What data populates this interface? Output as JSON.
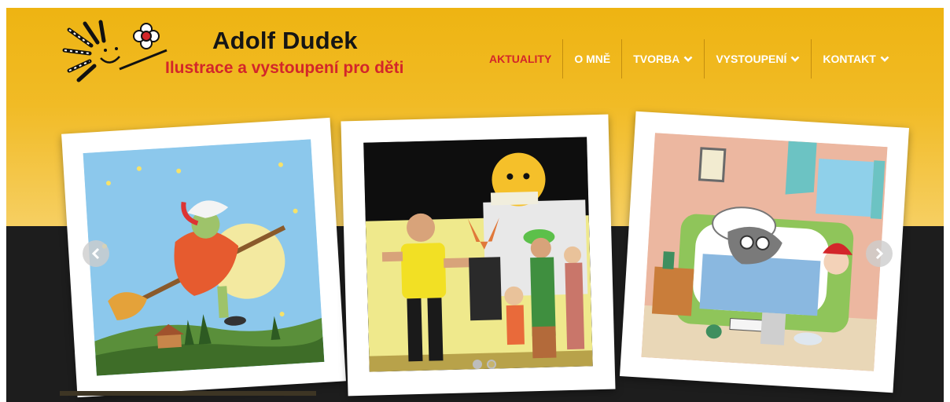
{
  "brand": {
    "name": "Adolf Dudek",
    "tagline": "Ilustrace a vystoupení pro děti"
  },
  "nav": {
    "items": [
      {
        "label": "AKTUALITY",
        "active": true,
        "dropdown": false
      },
      {
        "label": "O MNĚ",
        "active": false,
        "dropdown": false
      },
      {
        "label": "TVORBA",
        "active": false,
        "dropdown": true
      },
      {
        "label": "VYSTOUPENÍ",
        "active": false,
        "dropdown": true
      },
      {
        "label": "KONTAKT",
        "active": false,
        "dropdown": true
      }
    ]
  },
  "slider": {
    "slides": [
      {
        "subject": "witch-on-broom-illustration"
      },
      {
        "subject": "stage-performance-photo"
      },
      {
        "subject": "wolf-in-bed-illustration"
      }
    ],
    "dot_count": 2,
    "active_dot": 1
  },
  "colors": {
    "header_yellow": "#f1bb26",
    "accent_red": "#d3262a",
    "dark_band": "#1d1d1d",
    "nav_text": "#ffffff"
  },
  "icons": {
    "logo": "sun-flower-logo-icon",
    "dropdown": "chevron-down-icon",
    "prev": "chevron-left-icon",
    "next": "chevron-right-icon"
  }
}
